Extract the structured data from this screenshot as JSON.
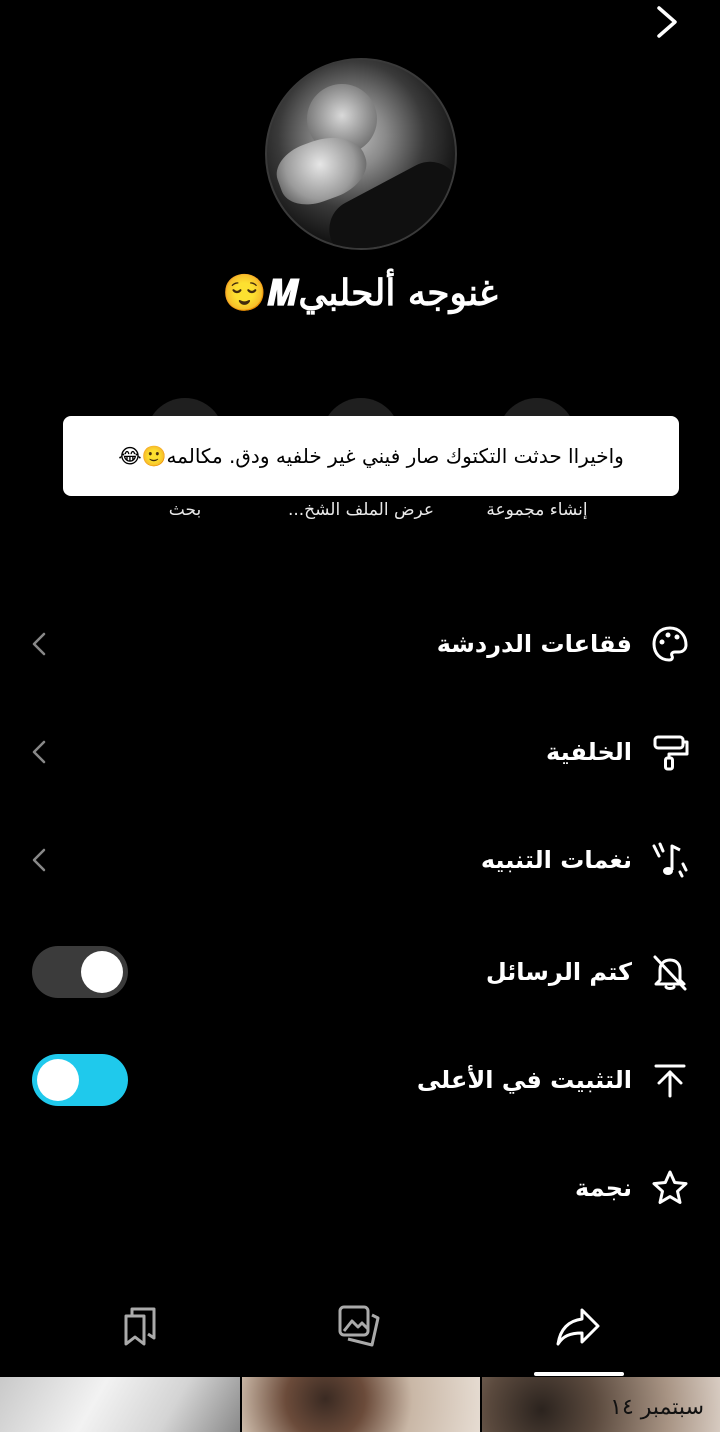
{
  "header": {
    "back_icon": "chevron-right-icon",
    "contact_name": "غنوجه ألحلبي𝑴😌"
  },
  "toast": {
    "message": "واخيراا حدثت التكتوك صار فيني غير خلفيه ودق.  مكالمه🙂😂"
  },
  "actions": [
    {
      "label": "إنشاء مجموعة"
    },
    {
      "label": "عرض الملف الشخ..."
    },
    {
      "label": "بحث"
    }
  ],
  "settings": [
    {
      "label": "فقاعات الدردشة",
      "icon": "palette-icon"
    },
    {
      "label": "الخلفية",
      "icon": "paint-roller-icon"
    },
    {
      "label": "نغمات التنبيه",
      "icon": "music-note-icon"
    },
    {
      "label": "كتم الرسائل",
      "icon": "bell-off-icon",
      "toggle": false
    },
    {
      "label": "التثبيت في الأعلى",
      "icon": "pin-top-icon",
      "toggle": true
    },
    {
      "label": "نجمة",
      "icon": "star-icon"
    }
  ],
  "bottom_nav": [
    {
      "icon": "bookmarks-icon"
    },
    {
      "icon": "media-icon"
    },
    {
      "icon": "share-icon",
      "selected": true
    }
  ],
  "media_strip": {
    "date_label": "سبتمبر ١٤"
  },
  "colors": {
    "background": "#000000",
    "toggle_on": "#1fc9ec",
    "toggle_off": "#3b3b3b"
  }
}
